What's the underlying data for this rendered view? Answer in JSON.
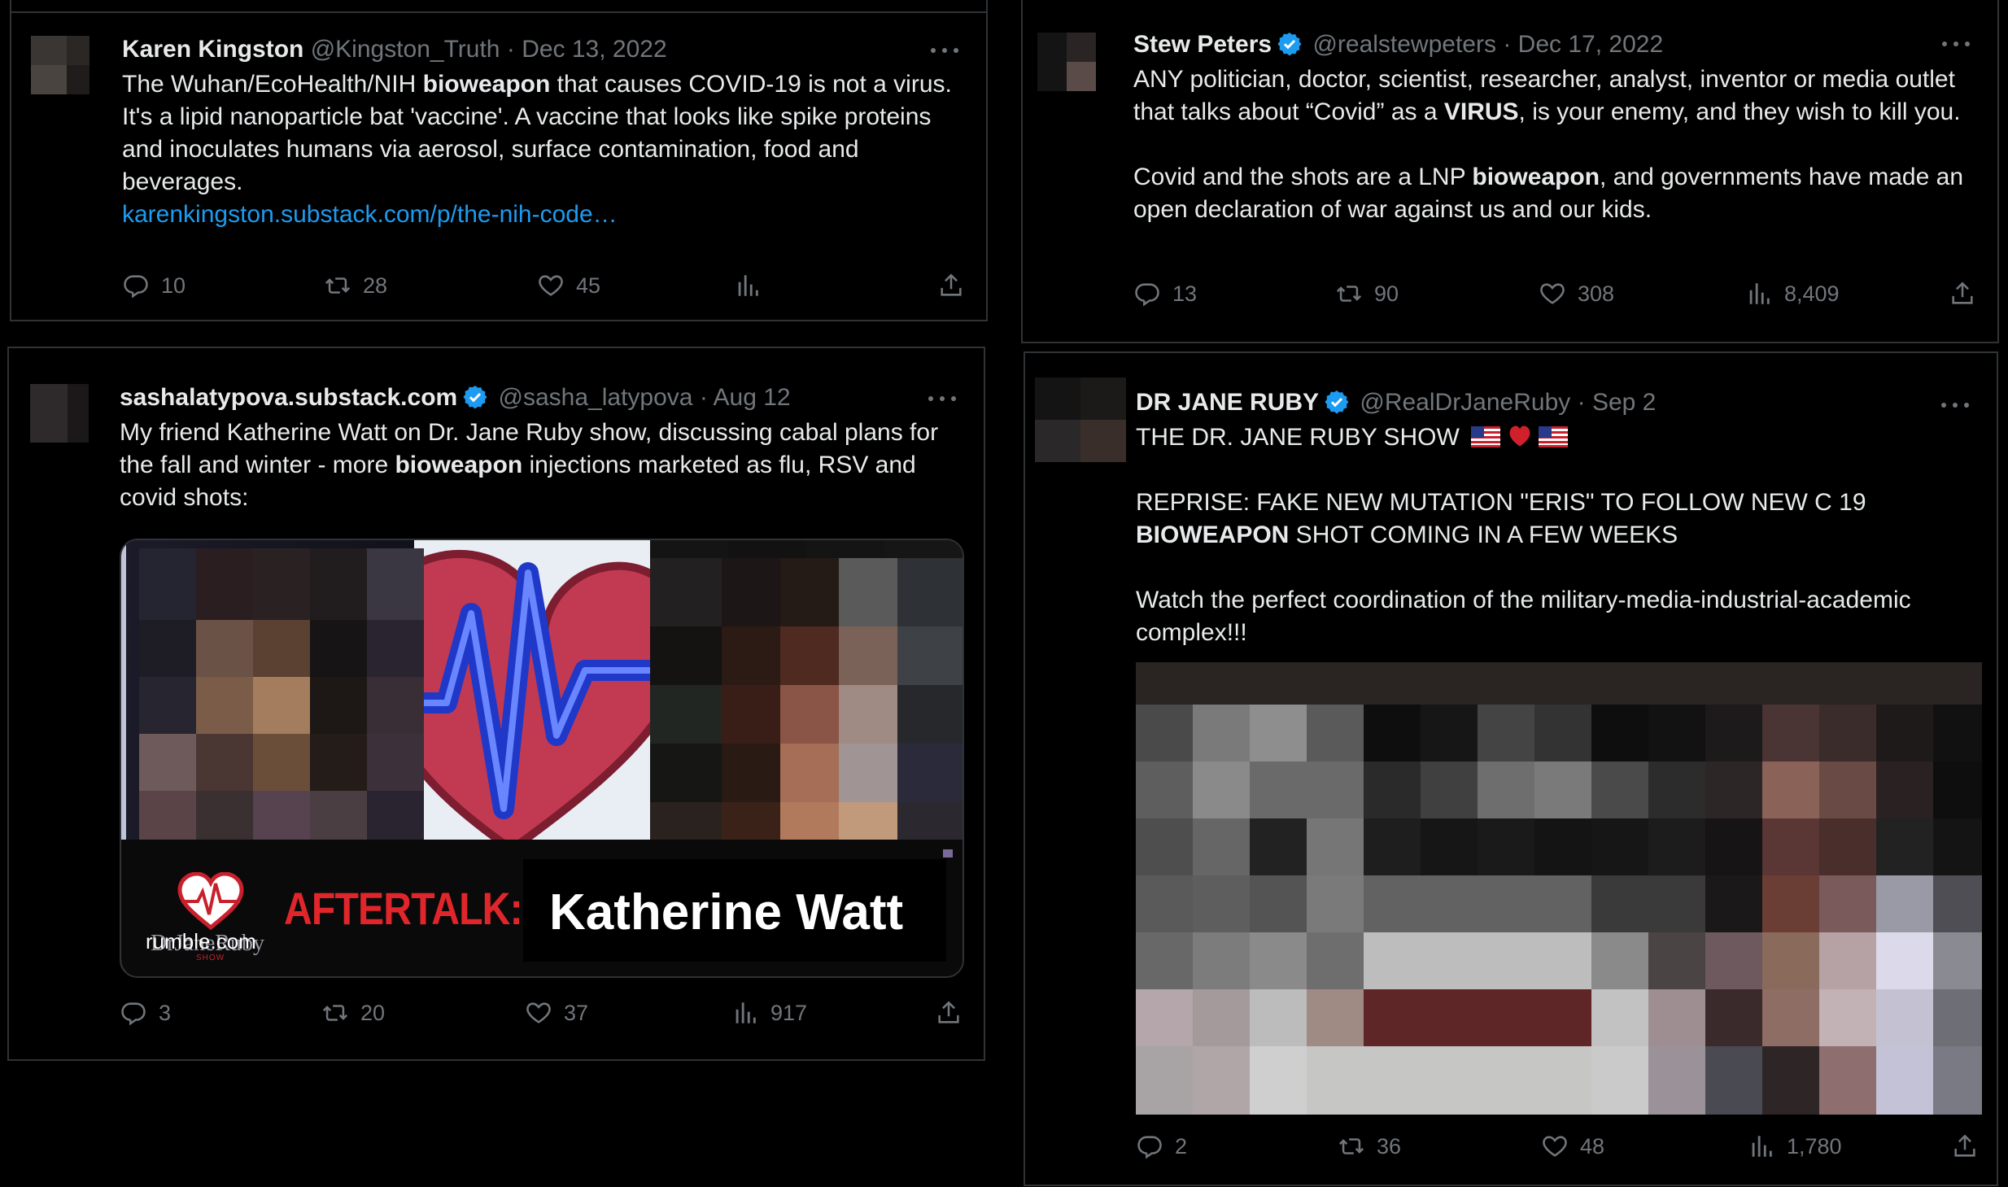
{
  "tweets": [
    {
      "name": "Karen Kingston",
      "handle": "@Kingston_Truth",
      "dot": "·",
      "date": "Dec 13, 2022",
      "text_parts": [
        "The Wuhan/EcoHealth/NIH ",
        "bioweapon",
        " that causes COVID-19 is not a virus. It's a lipid nanoparticle bat 'vaccine'. A vaccine that looks like spike proteins and inoculates humans via aerosol, surface contamination, food and beverages."
      ],
      "link": "karenkingston.substack.com/p/the-nih-code…",
      "replies": "10",
      "retweets": "28",
      "likes": "45",
      "views": ""
    },
    {
      "name": "Stew Peters",
      "handle": "@realstewpeters",
      "dot": "·",
      "date": "Dec 17, 2022",
      "p1_parts": [
        "ANY politician, doctor, scientist, researcher, analyst, inventor or media outlet that talks about “Covid” as a ",
        "VIRUS",
        ", is your enemy, and they wish to kill you."
      ],
      "p2_parts": [
        "Covid and the shots are a LNP ",
        "bioweapon",
        ", and governments have made an open declaration of war against us and our kids."
      ],
      "replies": "13",
      "retweets": "90",
      "likes": "308",
      "views": "8,409"
    },
    {
      "name": "sashalatypova.substack.com",
      "handle": "@sasha_latypova",
      "dot": "·",
      "date": "Aug 12",
      "text_parts": [
        "My friend Katherine Watt on Dr. Jane Ruby show, discussing cabal plans for the fall and winter - more ",
        "bioweapon",
        " injections marketed as flu, RSV and covid shots:"
      ],
      "media": {
        "logo_text": "DrJaneRuby",
        "logo_sub": "SHOW",
        "aftertalk": "AFTERTALK:",
        "guest": "Katherine Watt",
        "source": "rumble.com"
      },
      "replies": "3",
      "retweets": "20",
      "likes": "37",
      "views": "917"
    },
    {
      "name": "DR JANE RUBY",
      "handle": "@RealDrJaneRuby",
      "dot": "·",
      "date": "Sep 2",
      "line1": "THE DR. JANE RUBY SHOW",
      "p2_parts": [
        "REPRISE:  FAKE NEW MUTATION \"ERIS\" TO FOLLOW NEW C 19 ",
        "BIOWEAPON",
        " SHOT COMING IN A FEW WEEKS"
      ],
      "p3": "Watch the perfect coordination of the military-media-industrial-academic complex!!!",
      "replies": "2",
      "retweets": "36",
      "likes": "48",
      "views": "1,780"
    }
  ],
  "icons": {
    "reply": "reply-icon",
    "retweet": "retweet-icon",
    "like": "like-icon",
    "views": "views-icon",
    "share": "share-icon",
    "verified": "verified-badge-icon",
    "more": "more-icon"
  },
  "colors": {
    "background": "#000000",
    "text": "#e7e9ea",
    "muted": "#71767b",
    "link": "#1d9bf0",
    "verified": "#1d9bf0",
    "aftertalk": "#e0262b"
  }
}
